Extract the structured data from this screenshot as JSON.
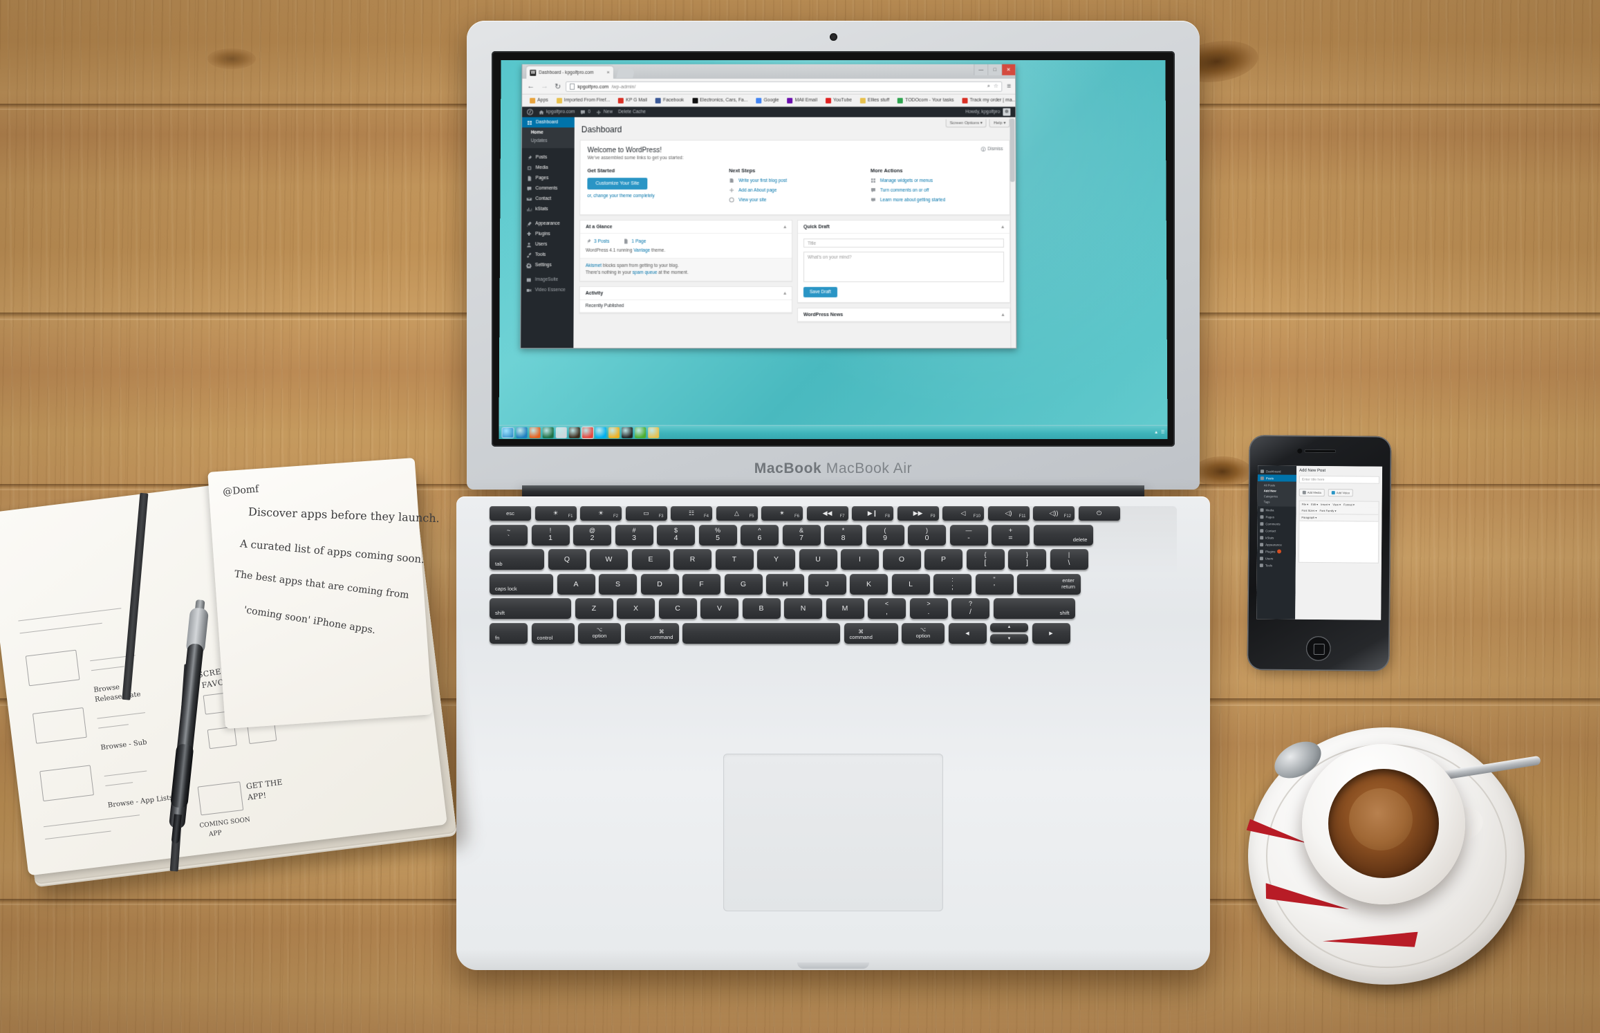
{
  "scene": {
    "title": "Desk flat-lay with MacBook Air showing WordPress dashboard",
    "laptop_label": "MacBook Air"
  },
  "browser": {
    "tab_title": "Dashboard - kpgolfpro.com",
    "tab_close": "×",
    "nav": {
      "back": "←",
      "forward": "→",
      "reload": "↻"
    },
    "url_domain": "kpgolfpro.com",
    "url_path": "/wp-admin/",
    "omnibox_icons": {
      "search": "⌕",
      "star": "☆"
    },
    "menu_icon": "≡",
    "window_controls": {
      "minimize": "—",
      "maximize": "□",
      "close": "✕"
    },
    "bookmarks": [
      {
        "label": "Apps",
        "color": "#e8a33d"
      },
      {
        "label": "Imported From Firef...",
        "color": "#e8c14d"
      },
      {
        "label": "KP G Mail",
        "color": "#d93025"
      },
      {
        "label": "Facebook",
        "color": "#3b5998"
      },
      {
        "label": "Electronics, Cars, Fa...",
        "color": "#111111"
      },
      {
        "label": "Google",
        "color": "#4285f4"
      },
      {
        "label": "MAil Email",
        "color": "#6a0dad"
      },
      {
        "label": "YouTube",
        "color": "#e02020"
      },
      {
        "label": "Ellies stuff",
        "color": "#e8c14d"
      },
      {
        "label": "TODOcom - Your tasks",
        "color": "#2ea44f"
      },
      {
        "label": "Track my order | ma...",
        "color": "#d93025"
      }
    ],
    "bookmarks_overflow": "»"
  },
  "wp_adminbar": {
    "logo": "wordpress-logo",
    "site_name": "kpgolfpro.com",
    "comment_count": "0",
    "new_label": "New",
    "delete_cache_label": "Delete Cache",
    "howdy": "Howdy, kpgolfpro"
  },
  "wp_sidebar": {
    "current": "Dashboard",
    "items": [
      {
        "label": "Dashboard",
        "icon": "dashboard-icon",
        "current": true
      },
      {
        "label": "Posts",
        "icon": "pin-icon"
      },
      {
        "label": "Media",
        "icon": "media-icon"
      },
      {
        "label": "Pages",
        "icon": "page-icon"
      },
      {
        "label": "Comments",
        "icon": "comment-icon"
      },
      {
        "label": "Contact",
        "icon": "contact-icon"
      },
      {
        "label": "kStats",
        "icon": "stats-icon"
      },
      {
        "label": "Appearance",
        "icon": "brush-icon"
      },
      {
        "label": "Plugins",
        "icon": "plugin-icon"
      },
      {
        "label": "Users",
        "icon": "users-icon"
      },
      {
        "label": "Tools",
        "icon": "tools-icon"
      },
      {
        "label": "Settings",
        "icon": "settings-icon"
      },
      {
        "label": "ImageSuite",
        "icon": "image-icon"
      },
      {
        "label": "Video Essence",
        "icon": "video-icon"
      }
    ],
    "submenu": [
      {
        "label": "Home",
        "active": true
      },
      {
        "label": "Updates",
        "active": false
      }
    ]
  },
  "wp_main": {
    "page_title": "Dashboard",
    "screen_options": "Screen Options",
    "help": "Help",
    "caret": "▾"
  },
  "welcome": {
    "title": "Welcome to WordPress!",
    "subtitle": "We've assembled some links to get you started:",
    "dismiss": "Dismiss",
    "get_started": {
      "heading": "Get Started",
      "button": "Customize Your Site",
      "alt_text": "or, change your theme completely"
    },
    "next_steps": {
      "heading": "Next Steps",
      "items": [
        {
          "label": "Write your first blog post",
          "icon": "write-icon"
        },
        {
          "label": "Add an About page",
          "icon": "plus-icon"
        },
        {
          "label": "View your site",
          "icon": "view-site-icon"
        }
      ]
    },
    "more_actions": {
      "heading": "More Actions",
      "items": [
        {
          "label": "Manage widgets or menus",
          "icon": "widgets-icon"
        },
        {
          "label": "Turn comments on or off",
          "icon": "comment-toggle-icon"
        },
        {
          "label": "Learn more about getting started",
          "icon": "learn-icon"
        }
      ]
    }
  },
  "at_a_glance": {
    "title": "At a Glance",
    "toggle": "▴",
    "posts": "3 Posts",
    "pages": "1 Page",
    "version_prefix": "WordPress 4.1 running",
    "theme_name": "Vantage",
    "version_suffix": "theme.",
    "akismet_name": "Akismet",
    "akismet_line1": "blocks spam from getting to your blog.",
    "akismet_line2_pre": "There's nothing in your",
    "akismet_link": "spam queue",
    "akismet_line2_post": "at the moment."
  },
  "activity": {
    "title": "Activity",
    "toggle": "▴",
    "subhead": "Recently Published"
  },
  "quick_draft": {
    "title": "Quick Draft",
    "toggle": "▴",
    "title_placeholder": "Title",
    "content_placeholder": "What's on your mind?",
    "save_button": "Save Draft"
  },
  "wp_news": {
    "title": "WordPress News",
    "toggle": "▴"
  },
  "taskbar": {
    "start": "start-button",
    "items": [
      {
        "name": "internet-explorer-icon",
        "color": "#1e7fc0"
      },
      {
        "name": "firefox-icon",
        "color": "#e8601c"
      },
      {
        "name": "excel-icon",
        "color": "#1d7044"
      },
      {
        "name": "paint-icon",
        "color": "#cfd6dc"
      },
      {
        "name": "bird-icon",
        "color": "#3a2a1a"
      },
      {
        "name": "chrome-icon",
        "color": "#e8453c",
        "active": true
      },
      {
        "name": "skype-icon",
        "color": "#00aff0"
      },
      {
        "name": "waterfox-icon",
        "color": "#f2b01e"
      },
      {
        "name": "inkscape-icon",
        "color": "#222222"
      },
      {
        "name": "utorrent-icon",
        "color": "#4cae2e"
      },
      {
        "name": "folder-icon",
        "color": "#e8c14d"
      }
    ]
  },
  "keyboard": {
    "fn_row": [
      {
        "main": "esc"
      },
      {
        "icon": "brightness-down-icon",
        "fn": "F1"
      },
      {
        "icon": "brightness-up-icon",
        "fn": "F2"
      },
      {
        "icon": "mission-control-icon",
        "fn": "F3"
      },
      {
        "icon": "launchpad-icon",
        "fn": "F4"
      },
      {
        "icon": "keyboard-dim-icon",
        "fn": "F5"
      },
      {
        "icon": "keyboard-bright-icon",
        "fn": "F6"
      },
      {
        "icon": "rewind-icon",
        "fn": "F7"
      },
      {
        "icon": "playpause-icon",
        "fn": "F8"
      },
      {
        "icon": "fastforward-icon",
        "fn": "F9"
      },
      {
        "icon": "mute-icon",
        "fn": "F10"
      },
      {
        "icon": "volume-down-icon",
        "fn": "F11"
      },
      {
        "icon": "volume-up-icon",
        "fn": "F12"
      },
      {
        "icon": "power-icon"
      }
    ],
    "number_row": [
      {
        "top": "~",
        "bottom": "`"
      },
      {
        "top": "!",
        "bottom": "1"
      },
      {
        "top": "@",
        "bottom": "2"
      },
      {
        "top": "#",
        "bottom": "3"
      },
      {
        "top": "$",
        "bottom": "4"
      },
      {
        "top": "%",
        "bottom": "5"
      },
      {
        "top": "^",
        "bottom": "6"
      },
      {
        "top": "&",
        "bottom": "7"
      },
      {
        "top": "*",
        "bottom": "8"
      },
      {
        "top": "(",
        "bottom": "9"
      },
      {
        "top": ")",
        "bottom": "0"
      },
      {
        "top": "—",
        "bottom": "-"
      },
      {
        "top": "+",
        "bottom": "="
      }
    ],
    "delete": "delete",
    "tab": "tab",
    "q_row": [
      "Q",
      "W",
      "E",
      "R",
      "T",
      "Y",
      "U",
      "I",
      "O",
      "P"
    ],
    "q_row_extra": [
      {
        "top": "{",
        "bottom": "["
      },
      {
        "top": "}",
        "bottom": "]"
      },
      {
        "top": "|",
        "bottom": "\\"
      }
    ],
    "caps": "caps lock",
    "a_row": [
      "A",
      "S",
      "D",
      "F",
      "G",
      "H",
      "J",
      "K",
      "L"
    ],
    "a_row_extra": [
      {
        "top": ":",
        "bottom": ";"
      },
      {
        "top": "\"",
        "bottom": "'"
      }
    ],
    "enter": "enter\nreturn",
    "enter_l1": "enter",
    "enter_l2": "return",
    "shift": "shift",
    "z_row": [
      "Z",
      "X",
      "C",
      "V",
      "B",
      "N",
      "M"
    ],
    "z_row_extra": [
      {
        "top": "<",
        "bottom": ","
      },
      {
        "top": ">",
        "bottom": "."
      },
      {
        "top": "?",
        "bottom": "/"
      }
    ],
    "bottom": {
      "fn": "fn",
      "control": "control",
      "option": "option",
      "command_glyph": "⌘",
      "command": "command",
      "option_glyph": "⌥",
      "arrow_left": "◀",
      "arrow_up": "▲",
      "arrow_down": "▼",
      "arrow_right": "▶"
    }
  },
  "phone": {
    "app_title": "Add New Post",
    "title_placeholder": "Enter title here",
    "add_media": "Add Media",
    "add_video": "Add Video",
    "toolbar1": [
      "File",
      "Edit",
      "Insert",
      "View",
      "Format"
    ],
    "toolbar2": [
      "Font Sizes",
      "Font Family"
    ],
    "toolbar3": [
      "Paragraph"
    ],
    "menu": [
      {
        "label": "Dashboard"
      },
      {
        "label": "Posts",
        "current": true
      },
      {
        "label": "Media"
      },
      {
        "label": "Pages"
      },
      {
        "label": "Comments"
      },
      {
        "label": "Contact"
      },
      {
        "label": "kStats"
      },
      {
        "label": "Appearance"
      },
      {
        "label": "Plugins",
        "badge": "1"
      },
      {
        "label": "Users"
      },
      {
        "label": "Tools"
      }
    ],
    "submenu": [
      {
        "label": "All Posts"
      },
      {
        "label": "Add New",
        "active": true
      },
      {
        "label": "Categories"
      },
      {
        "label": "Tags"
      }
    ]
  },
  "notebook": {
    "header": "@Domf",
    "line1": "Discover apps before they launch.",
    "line2": "A curated list of apps coming soon.",
    "line3": "The best apps that are coming from",
    "line4": "'coming soon' iPhone apps.",
    "sketch_labels": [
      "Discover apps before they launch",
      "Browse",
      "Release Date",
      "Browse - Sub",
      "Browse - App Lists",
      "SCREENS AND FAVORITES",
      "GET THE APP!",
      "COMING SOON APP"
    ]
  },
  "coffee": {
    "item": "espresso-cup",
    "accent_color": "#b81c26"
  }
}
